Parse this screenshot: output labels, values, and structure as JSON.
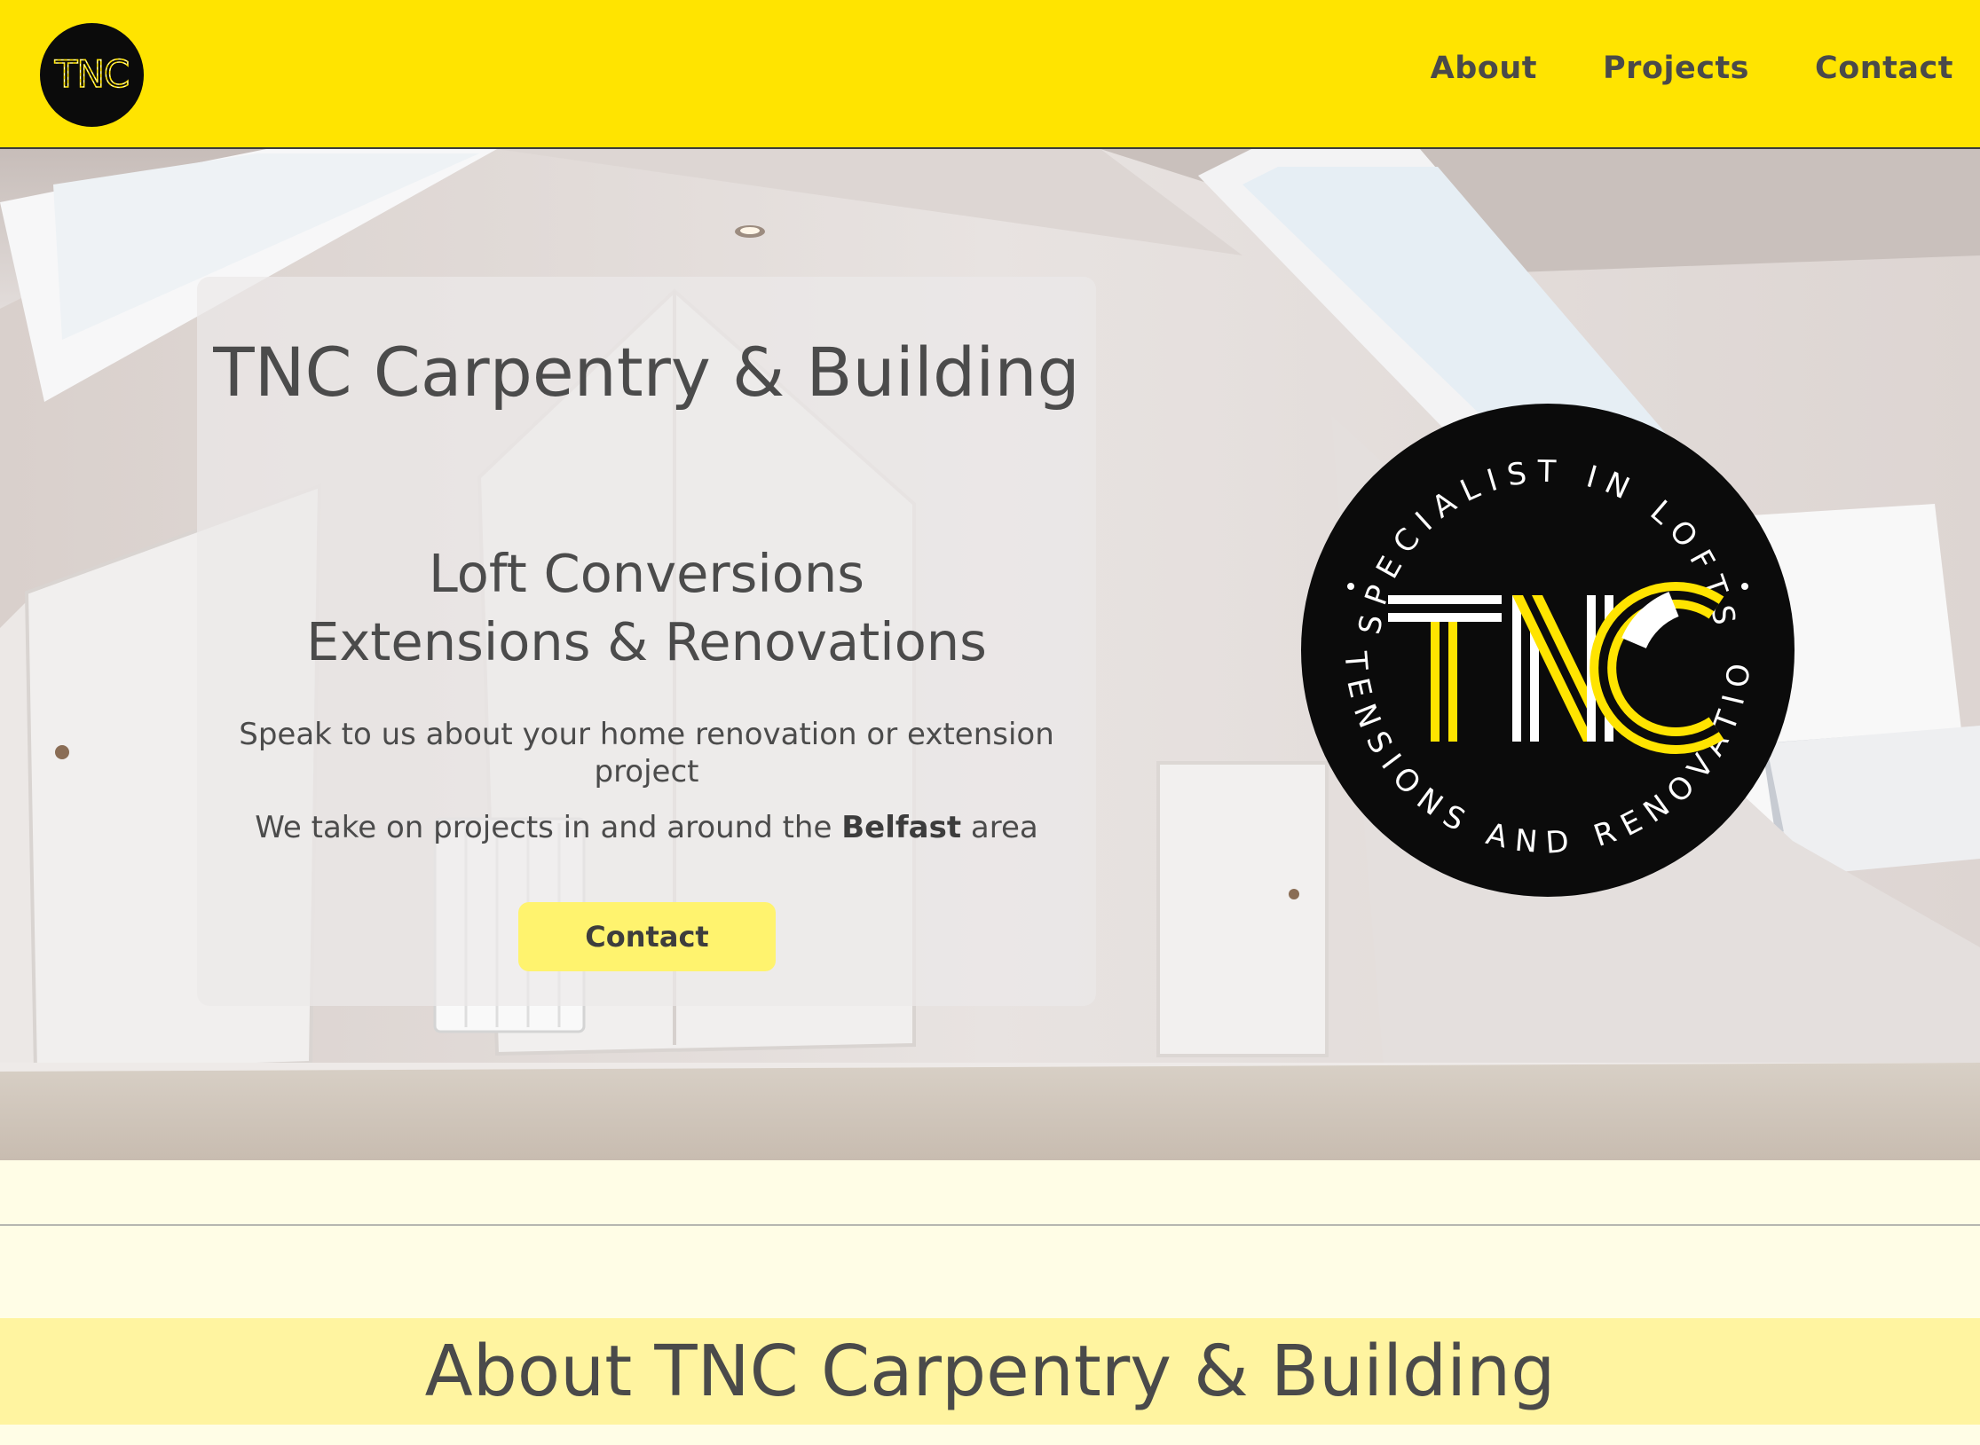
{
  "header": {
    "logo_text": "TNC",
    "nav": [
      {
        "label": "About"
      },
      {
        "label": "Projects"
      },
      {
        "label": "Contact"
      }
    ]
  },
  "hero": {
    "title": "TNC Carpentry & Building",
    "subtitle_line1": "Loft Conversions",
    "subtitle_line2": "Extensions & Renovations",
    "paragraph1": "Speak to us about your home renovation or extension project",
    "paragraph2_before": "We take on projects in and around the ",
    "paragraph2_bold": "Belfast",
    "paragraph2_after": " area",
    "button_label": "Contact",
    "badge": {
      "center_text": "TNC",
      "ring_top": "SPECIALIST IN LOFTS",
      "ring_bottom": "EXTENSIONS AND RENOVATIONS"
    }
  },
  "about": {
    "heading": "About TNC Carpentry & Building"
  },
  "colors": {
    "brand_yellow": "#ffe400",
    "page_background": "#fffde6",
    "about_band": "#fff4a0",
    "button": "#fff36e",
    "badge_black": "#0b0b0b"
  }
}
